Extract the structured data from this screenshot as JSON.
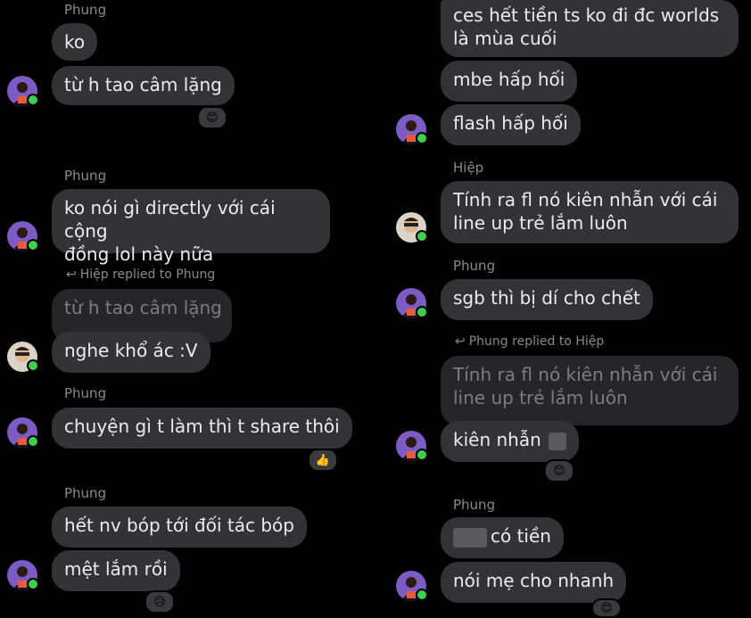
{
  "left": {
    "sender_1": "Phung",
    "msg_ko": "ko",
    "msg_tu_h": "từ h tao câm lặng",
    "reaction_1": "😊",
    "sender_2": "Phung",
    "msg_directly": "ko nói gì directly với cái cộng\nđồng lol này nữa",
    "reply_label_1": "Hiệp replied to Phung",
    "quoted_1": "từ h tao câm lặng",
    "msg_nghe": "nghe khổ ác :V",
    "sender_3": "Phung",
    "msg_chuyen": "chuyện gì t làm thì t share thôi",
    "reaction_2": "👍",
    "sender_4": "Phung",
    "msg_het_nv": "hết nv bóp tới đối tác bóp",
    "msg_met": "mệt lắm rồi",
    "reaction_3": "😥"
  },
  "right": {
    "msg_ces": "ces hết tiền ts ko đi đc worlds\nlà mùa cuối",
    "msg_mbe": "mbe hấp hối",
    "msg_flash": "flash hấp hối",
    "sender_1": "Hiệp",
    "msg_tinh": "Tính ra fl nó kiên nhẫn với cái\nline up trẻ lắm luôn",
    "sender_2": "Phung",
    "msg_sgb": "sgb thì bị dí cho chết",
    "reply_label_1": "Phung replied to Hiệp",
    "quoted_1": "Tính ra fl nó kiên nhẫn với cái\nline up trẻ lắm luôn",
    "msg_kien": "kiên nhẫn",
    "reaction_1": "😊",
    "sender_3": "Phung",
    "msg_co_tien": "có tiền",
    "msg_noi": "nói mẹ cho nhanh",
    "reaction_2": "😊"
  },
  "colors": {
    "background": "#000000",
    "bubble": "#333336",
    "quoted_bubble": "#262628",
    "online": "#3ccf4e",
    "avatar_purple": "#7b5cc4"
  },
  "icons": {
    "reply": "reply-arrow-icon",
    "online": "online-dot-icon"
  }
}
